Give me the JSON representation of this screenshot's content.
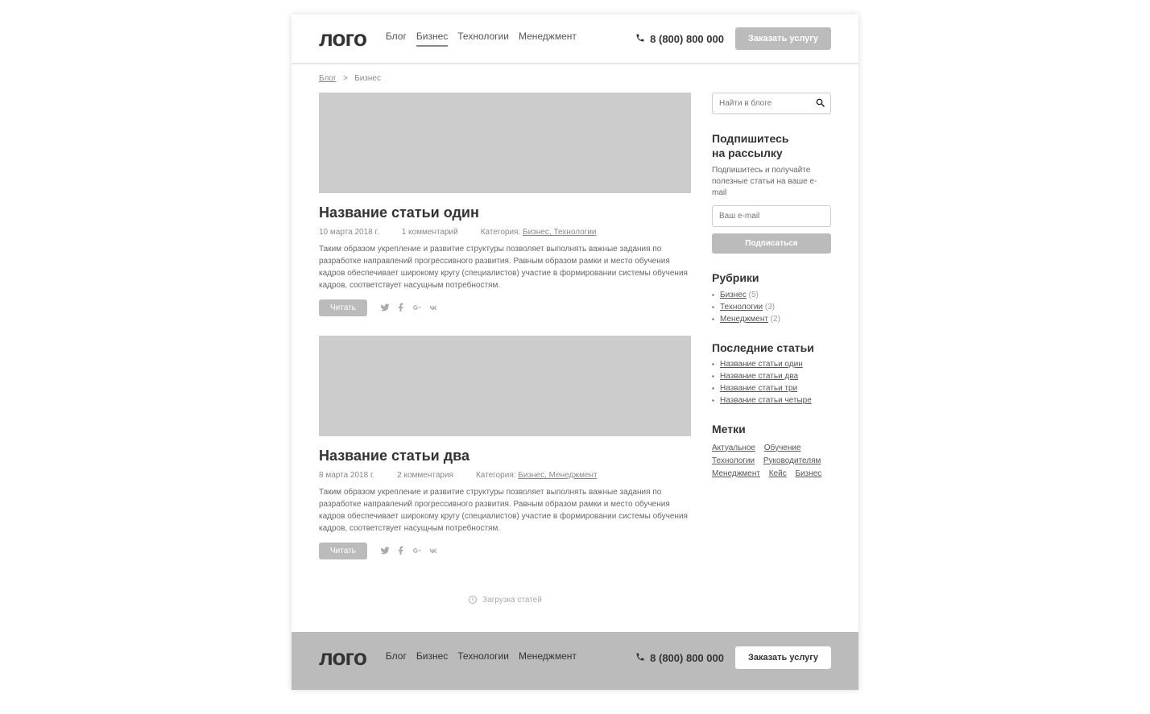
{
  "site": {
    "logo": "лого"
  },
  "nav": {
    "items": [
      {
        "label": "Блог",
        "active": false
      },
      {
        "label": "Бизнес",
        "active": true
      },
      {
        "label": "Технологии",
        "active": false
      },
      {
        "label": "Менеджмент",
        "active": false
      }
    ]
  },
  "header": {
    "phone": "8 (800) 800 000",
    "cta": "Заказать услугу"
  },
  "breadcrumb": {
    "root": "Блог",
    "sep": ">",
    "current": "Бизнес"
  },
  "articles": [
    {
      "title": "Название статьи один",
      "date": "10 марта 2018 г.",
      "comments": "1 комментарий",
      "category_prefix": "Категория: ",
      "categories": "Бизнес, Технологии",
      "excerpt": "Таким образом укрепление и развитие структуры позволяет выполнять важные задания по разработке направлений прогрессивного развития. Равным образом рамки и место обучения кадров обеспечивает широкому кругу (специалистов) участие в формировании системы обучения кадров, соответствует насущным потребностям.",
      "read": "Читать"
    },
    {
      "title": "Название статьи два",
      "date": "8 марта 2018 г.",
      "comments": "2 комментария",
      "category_prefix": "Категория: ",
      "categories": "Бизнес, Менеджмент",
      "excerpt": "Таким образом укрепление и развитие структуры позволяет выполнять важные задания по разработке направлений прогрессивного развития. Равным образом рамки и место обучения кадров обеспечивает широкому кругу (специалистов) участие в формировании системы обучения кадров, соответствует насущным потребностям.",
      "read": "Читать"
    }
  ],
  "loader": "Загрузка статей",
  "sidebar": {
    "search_placeholder": "Найти в блоге",
    "subscribe": {
      "heading_line1": "Подпишитесь",
      "heading_line2": "на рассылку",
      "text": "Подпишитесь и получайте полезные статьи на ваше e-mail",
      "email_placeholder": "Ваш e-mail",
      "button": "Подписаться"
    },
    "categories": {
      "heading": "Рубрики",
      "items": [
        {
          "label": "Бизнес",
          "count": "(5)"
        },
        {
          "label": "Технологии",
          "count": "(3)"
        },
        {
          "label": "Менеджмент",
          "count": "(2)"
        }
      ]
    },
    "recent": {
      "heading": "Последние статьи",
      "items": [
        {
          "label": "Название статьи один"
        },
        {
          "label": "Название статьи два"
        },
        {
          "label": "Название статьи три"
        },
        {
          "label": "Название статьи четыре"
        }
      ]
    },
    "tags": {
      "heading": "Метки",
      "items": [
        "Актуальное",
        "Обучение",
        "Технологии",
        "Руководителям",
        "Менеджмент",
        "Кейс",
        "Бизнес"
      ]
    }
  },
  "footer": {
    "phone": "8 (800) 800 000",
    "cta": "Заказать услугу"
  }
}
